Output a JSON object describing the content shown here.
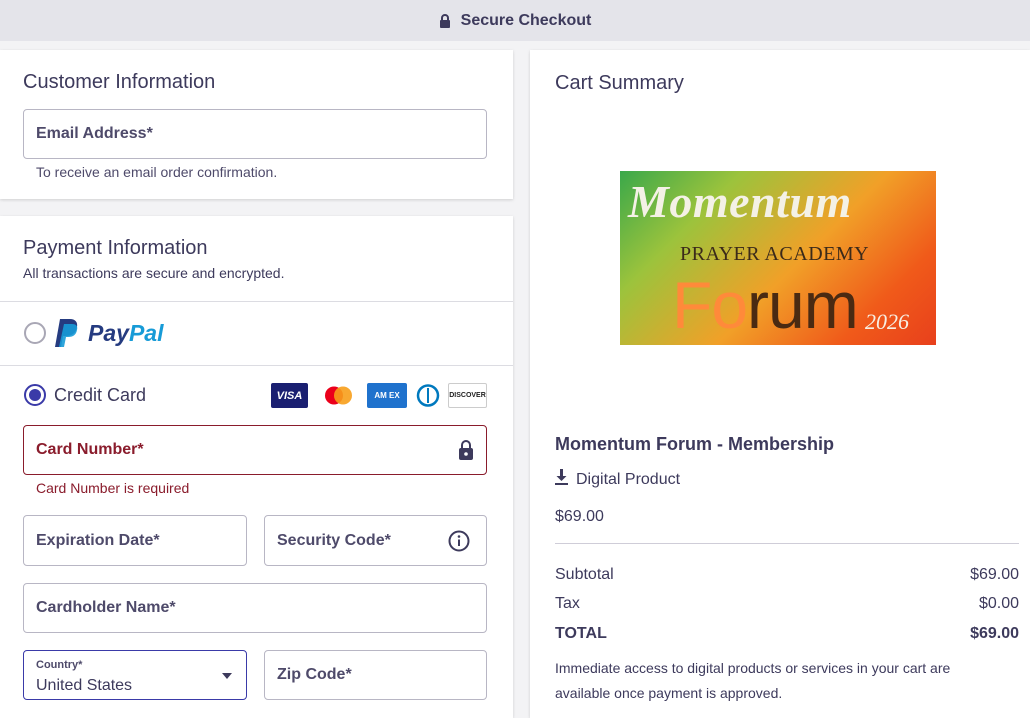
{
  "header": {
    "title": "Secure Checkout",
    "icon": "lock-icon"
  },
  "customer": {
    "title": "Customer Information",
    "email_label": "Email Address*",
    "email_help": "To receive an email order confirmation."
  },
  "payment": {
    "title": "Payment Information",
    "subtitle": "All transactions are secure and encrypted.",
    "paypal": {
      "word1": "Pay",
      "word2": "Pal"
    },
    "credit_card_label": "Credit Card",
    "brands": {
      "visa": "VISA",
      "amex": "AM EX",
      "discover": "DISCOVER"
    },
    "card_number_label": "Card Number*",
    "card_number_error": "Card Number is required",
    "expiration_label": "Expiration Date*",
    "security_label": "Security Code*",
    "cardholder_label": "Cardholder Name*",
    "country_label": "Country*",
    "country_value": "United States",
    "zip_label": "Zip Code*"
  },
  "cart": {
    "title": "Cart Summary",
    "banner": {
      "line1": "Momentum",
      "line2": "PRAYER ACADEMY",
      "line3a": "Fo",
      "line3b": "rum",
      "line4": "2026"
    },
    "product_name": "Momentum Forum - Membership",
    "product_type": "Digital Product",
    "product_price": "$69.00",
    "subtotal_label": "Subtotal",
    "subtotal_value": "$69.00",
    "tax_label": "Tax",
    "tax_value": "$0.00",
    "total_label": "TOTAL",
    "total_value": "$69.00",
    "note": "Immediate access to digital products or services in your cart are available once payment is approved."
  },
  "colors": {
    "accent": "#3a3aa8",
    "error": "#8a1c2c",
    "text": "#3d3a5c"
  }
}
